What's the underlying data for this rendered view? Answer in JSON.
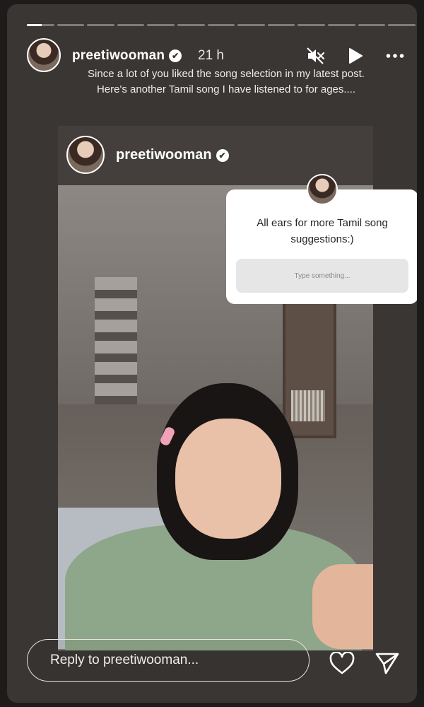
{
  "story": {
    "segments_total": 13,
    "active_segment": 1,
    "active_progress": 0.55
  },
  "header": {
    "username": "preetiwooman",
    "verified_icon": "✔",
    "time": "21 h",
    "caption_line1": "Since a lot of you liked the song selection in my latest post.",
    "caption_line2": "Here's another Tamil song I have listened to for ages....",
    "icons": [
      "mute-icon",
      "play-icon",
      "more-icon"
    ]
  },
  "post": {
    "username": "preetiwooman",
    "verified_icon": "✔"
  },
  "sticker": {
    "question": "All ears for more Tamil song suggestions:)",
    "placeholder": "Type something..."
  },
  "reply": {
    "placeholder": "Reply to preetiwooman..."
  },
  "colors": {
    "background": "#3a3634",
    "outer": "#1e1c1b",
    "sticker": "#ffffff"
  }
}
